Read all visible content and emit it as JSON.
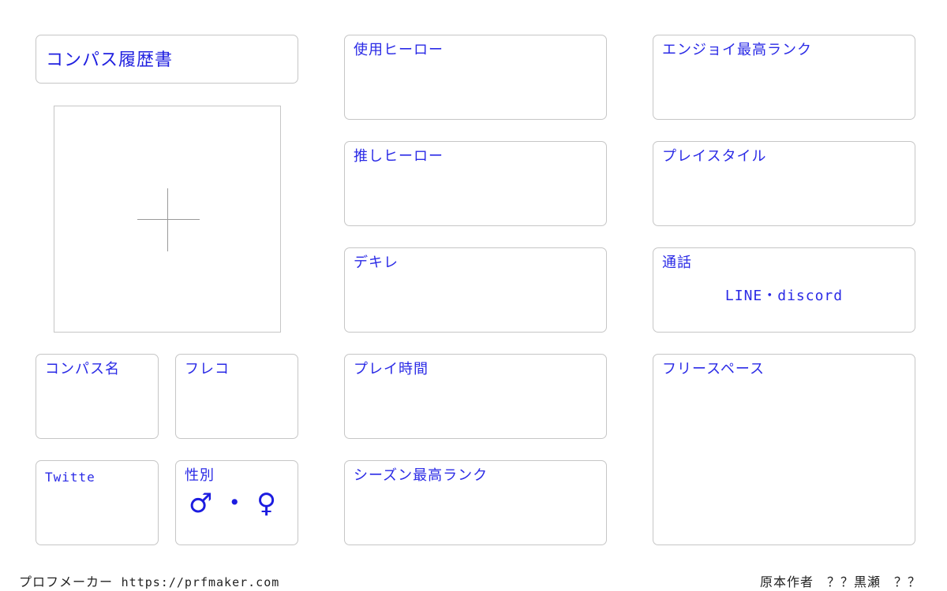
{
  "title": "コンパス履歴書",
  "left_fields": {
    "compass_name": "コンパス名",
    "friend_code": "フレコ",
    "twitter": "Twitte",
    "gender": "性別",
    "gender_options": "♂ ・ ♀"
  },
  "middle_fields": {
    "used_hero": "使用ヒーロー",
    "favorite_hero": "推しヒーロー",
    "dekire": "デキレ",
    "play_time": "プレイ時間",
    "season_max_rank": "シーズン最高ランク"
  },
  "right_fields": {
    "enjoy_max_rank": "エンジョイ最高ランク",
    "play_style": "プレイスタイル",
    "voice_chat": "通話",
    "voice_chat_value": "LINE・discord",
    "free_space": "フリースペース"
  },
  "footer": {
    "maker_label": "プロフメーカー",
    "maker_url": "https://prfmaker.com",
    "author": "原本作者　？？黒瀬　？？"
  },
  "colors": {
    "label_blue": "#2a2ae6",
    "border_gray": "#c6c6c6"
  },
  "icons": {
    "photo_placeholder": "plus-crosshair"
  }
}
